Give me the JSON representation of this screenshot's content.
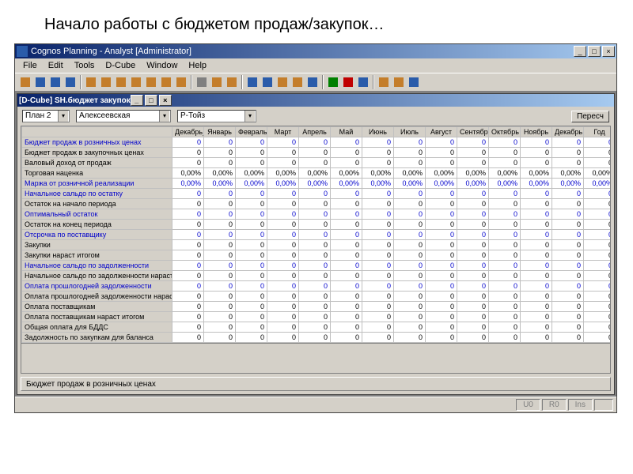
{
  "slide_title": "Начало работы с бюджетом продаж/закупок…",
  "main_title": "Cognos Planning - Analyst [Administrator]",
  "menu": [
    "File",
    "Edit",
    "Tools",
    "D-Cube",
    "Window",
    "Help"
  ],
  "inner_title": "[D-Cube] SH.бюджет закупок",
  "filters": {
    "plan": "План 2",
    "loc": "Алексеевская",
    "prod": "Р-Тойз"
  },
  "refresh_btn": "Пересч",
  "formula_bar": "Бюджет продаж в розничных ценах",
  "status": {
    "u0": "U0",
    "r0": "R0",
    "ins": "Ins"
  },
  "columns": [
    "Декабрь_Пред",
    "Январь",
    "Февраль",
    "Март",
    "Апрель",
    "Май",
    "Июнь",
    "Июль",
    "Август",
    "Сентябрь",
    "Октябрь",
    "Ноябрь",
    "Декабрь",
    "Год"
  ],
  "rows": [
    {
      "label": "Бюджет продаж в розничных ценах",
      "color": "blue",
      "vals": [
        "0",
        "0",
        "0",
        "0",
        "0",
        "0",
        "0",
        "0",
        "0",
        "0",
        "0",
        "0",
        "0",
        "0"
      ]
    },
    {
      "label": "Бюджет продаж в закупочных ценах",
      "color": "black",
      "vals": [
        "0",
        "0",
        "0",
        "0",
        "0",
        "0",
        "0",
        "0",
        "0",
        "0",
        "0",
        "0",
        "0",
        "0"
      ]
    },
    {
      "label": "Валовый доход от продаж",
      "color": "black",
      "vals": [
        "0",
        "0",
        "0",
        "0",
        "0",
        "0",
        "0",
        "0",
        "0",
        "0",
        "0",
        "0",
        "0",
        "0"
      ]
    },
    {
      "label": "Торговая наценка",
      "color": "black",
      "vals": [
        "0,00%",
        "0,00%",
        "0,00%",
        "0,00%",
        "0,00%",
        "0,00%",
        "0,00%",
        "0,00%",
        "0,00%",
        "0,00%",
        "0,00%",
        "0,00%",
        "0,00%",
        "0,00%"
      ]
    },
    {
      "label": "Маржа от розничной реализации",
      "color": "blue",
      "vals": [
        "0,00%",
        "0,00%",
        "0,00%",
        "0,00%",
        "0,00%",
        "0,00%",
        "0,00%",
        "0,00%",
        "0,00%",
        "0,00%",
        "0,00%",
        "0,00%",
        "0,00%",
        "0,00%"
      ]
    },
    {
      "label": "Начальное сальдо по остатку",
      "color": "blue",
      "vals": [
        "0",
        "0",
        "0",
        "0",
        "0",
        "0",
        "0",
        "0",
        "0",
        "0",
        "0",
        "0",
        "0",
        "0"
      ]
    },
    {
      "label": "Остаток на начало периода",
      "color": "black",
      "vals": [
        "0",
        "0",
        "0",
        "0",
        "0",
        "0",
        "0",
        "0",
        "0",
        "0",
        "0",
        "0",
        "0",
        "0"
      ]
    },
    {
      "label": "Оптимальный остаток",
      "color": "blue",
      "vals": [
        "0",
        "0",
        "0",
        "0",
        "0",
        "0",
        "0",
        "0",
        "0",
        "0",
        "0",
        "0",
        "0",
        "0"
      ]
    },
    {
      "label": "Остаток на конец периода",
      "color": "black",
      "vals": [
        "0",
        "0",
        "0",
        "0",
        "0",
        "0",
        "0",
        "0",
        "0",
        "0",
        "0",
        "0",
        "0",
        "0"
      ]
    },
    {
      "label": "Отсрочка по поставщику",
      "color": "blue",
      "vals": [
        "0",
        "0",
        "0",
        "0",
        "0",
        "0",
        "0",
        "0",
        "0",
        "0",
        "0",
        "0",
        "0",
        "0"
      ]
    },
    {
      "label": "Закупки",
      "color": "black",
      "vals": [
        "0",
        "0",
        "0",
        "0",
        "0",
        "0",
        "0",
        "0",
        "0",
        "0",
        "0",
        "0",
        "0",
        "0"
      ]
    },
    {
      "label": "Закупки нараст итогом",
      "color": "black",
      "vals": [
        "0",
        "0",
        "0",
        "0",
        "0",
        "0",
        "0",
        "0",
        "0",
        "0",
        "0",
        "0",
        "0",
        "0"
      ]
    },
    {
      "label": "Начальное сальдо по задолженности",
      "color": "blue",
      "vals": [
        "0",
        "0",
        "0",
        "0",
        "0",
        "0",
        "0",
        "0",
        "0",
        "0",
        "0",
        "0",
        "0",
        "0"
      ]
    },
    {
      "label": "Начальное сальдо по задолженности нараст итогом",
      "color": "black",
      "vals": [
        "0",
        "0",
        "0",
        "0",
        "0",
        "0",
        "0",
        "0",
        "0",
        "0",
        "0",
        "0",
        "0",
        "0"
      ]
    },
    {
      "label": "Оплата прошлогодней задолженности",
      "color": "blue",
      "vals": [
        "0",
        "0",
        "0",
        "0",
        "0",
        "0",
        "0",
        "0",
        "0",
        "0",
        "0",
        "0",
        "0",
        "0"
      ]
    },
    {
      "label": "Оплата прошлогодней задолженности нараст итогом",
      "color": "black",
      "vals": [
        "0",
        "0",
        "0",
        "0",
        "0",
        "0",
        "0",
        "0",
        "0",
        "0",
        "0",
        "0",
        "0",
        "0"
      ]
    },
    {
      "label": "Оплата поставщикам",
      "color": "black",
      "vals": [
        "0",
        "0",
        "0",
        "0",
        "0",
        "0",
        "0",
        "0",
        "0",
        "0",
        "0",
        "0",
        "0",
        "0"
      ]
    },
    {
      "label": "Оплата поставщикам нараст итогом",
      "color": "black",
      "vals": [
        "0",
        "0",
        "0",
        "0",
        "0",
        "0",
        "0",
        "0",
        "0",
        "0",
        "0",
        "0",
        "0",
        "0"
      ]
    },
    {
      "label": "Общая оплата для БДДС",
      "color": "black",
      "vals": [
        "0",
        "0",
        "0",
        "0",
        "0",
        "0",
        "0",
        "0",
        "0",
        "0",
        "0",
        "0",
        "0",
        "0"
      ]
    },
    {
      "label": "Задолжность по закупкам для баланса",
      "color": "black",
      "vals": [
        "0",
        "0",
        "0",
        "0",
        "0",
        "0",
        "0",
        "0",
        "0",
        "0",
        "0",
        "0",
        "0",
        "0"
      ]
    }
  ],
  "icons": [
    "#c47e2b",
    "#2a5caa",
    "#2a5caa",
    "#2a5caa",
    "#c47e2b",
    "#c47e2b",
    "#c47e2b",
    "#c47e2b",
    "#c47e2b",
    "#c47e2b",
    "#c47e2b",
    "#808080",
    "#c47e2b",
    "#c47e2b",
    "#2a5caa",
    "#2a5caa",
    "#c47e2b",
    "#c47e2b",
    "#2a5caa",
    "#008000",
    "#c00000",
    "#2a5caa",
    "#c47e2b",
    "#c47e2b",
    "#2a5caa"
  ]
}
